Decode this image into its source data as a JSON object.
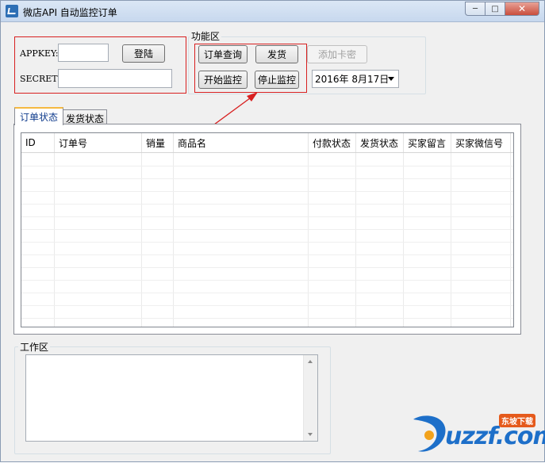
{
  "window": {
    "title": "微店API 自动监控订单"
  },
  "login": {
    "appkey_label": "APPKEY:",
    "secret_label": "SECRET:",
    "appkey_value": "",
    "secret_value": "",
    "login_button": "登陆"
  },
  "functions": {
    "group_title": "功能区",
    "query_button": "订单查询",
    "ship_button": "发货",
    "add_card_button": "添加卡密",
    "start_monitor_button": "开始监控",
    "stop_monitor_button": "停止监控",
    "date_value": "2016年  8月17日"
  },
  "tabs": [
    {
      "label": "订单状态",
      "active": true
    },
    {
      "label": "发货状态",
      "active": false
    }
  ],
  "table": {
    "columns": [
      "ID",
      "订单号",
      "销量",
      "商品名",
      "付款状态",
      "发货状态",
      "买家留言",
      "买家微信号"
    ],
    "rows": []
  },
  "work_area": {
    "title": "工作区",
    "content": ""
  },
  "watermark": {
    "brand": "uzzf.com",
    "tag": "东坡下载"
  },
  "colors": {
    "annotation_red": "#d82020",
    "tab_accent": "#f5b942",
    "watermark_blue": "#1d6fc9"
  },
  "icons": {
    "app": "app-logo-icon",
    "minimize": "minimize-icon",
    "maximize": "maximize-icon",
    "close": "close-icon"
  }
}
